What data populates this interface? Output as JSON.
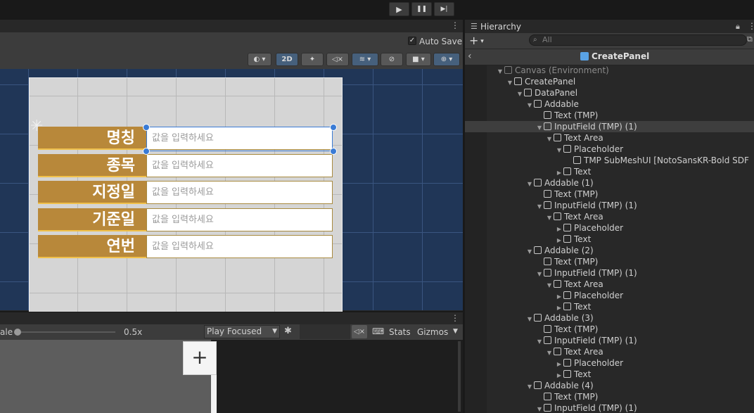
{
  "playbar": {
    "play_icon": "▶",
    "pause_icon": "❚❚",
    "step_icon": "▶|"
  },
  "scene": {
    "auto_save_label": "Auto Save",
    "mode_2d_label": "2D",
    "rows": [
      {
        "label": "명칭",
        "placeholder": "값을 입력하세요"
      },
      {
        "label": "종목",
        "placeholder": "값을 입력하세요"
      },
      {
        "label": "지정일",
        "placeholder": "값을 입력하세요"
      },
      {
        "label": "기준일",
        "placeholder": "값을 입력하세요"
      },
      {
        "label": "연번",
        "placeholder": "값을 입력하세요"
      }
    ]
  },
  "game": {
    "scale_label": "ale",
    "scale_value": "0.5x",
    "play_mode": "Play Focused",
    "stats_label": "Stats",
    "gizmos_label": "Gizmos",
    "add_label": "+"
  },
  "hierarchy": {
    "tab_label": "Hierarchy",
    "search_placeholder": "All",
    "breadcrumb_title": "CreatePanel",
    "items": [
      {
        "label": "Canvas (Environment)",
        "indent": 0,
        "expanded": true,
        "dim": true
      },
      {
        "label": "CreatePanel",
        "indent": 1,
        "expanded": true
      },
      {
        "label": "DataPanel",
        "indent": 2,
        "expanded": true
      },
      {
        "label": "Addable",
        "indent": 3,
        "expanded": true
      },
      {
        "label": "Text (TMP)",
        "indent": 4,
        "expanded": null
      },
      {
        "label": "InputField (TMP) (1)",
        "indent": 4,
        "expanded": true,
        "selected": true
      },
      {
        "label": "Text Area",
        "indent": 5,
        "expanded": true
      },
      {
        "label": "Placeholder",
        "indent": 6,
        "expanded": true
      },
      {
        "label": "TMP SubMeshUI [NotoSansKR-Bold SDF",
        "indent": 7,
        "expanded": null
      },
      {
        "label": "Text",
        "indent": 6,
        "expanded": false
      },
      {
        "label": "Addable (1)",
        "indent": 3,
        "expanded": true
      },
      {
        "label": "Text (TMP)",
        "indent": 4,
        "expanded": null
      },
      {
        "label": "InputField (TMP) (1)",
        "indent": 4,
        "expanded": true
      },
      {
        "label": "Text Area",
        "indent": 5,
        "expanded": true
      },
      {
        "label": "Placeholder",
        "indent": 6,
        "expanded": false
      },
      {
        "label": "Text",
        "indent": 6,
        "expanded": false
      },
      {
        "label": "Addable (2)",
        "indent": 3,
        "expanded": true
      },
      {
        "label": "Text (TMP)",
        "indent": 4,
        "expanded": null
      },
      {
        "label": "InputField (TMP) (1)",
        "indent": 4,
        "expanded": true
      },
      {
        "label": "Text Area",
        "indent": 5,
        "expanded": true
      },
      {
        "label": "Placeholder",
        "indent": 6,
        "expanded": false
      },
      {
        "label": "Text",
        "indent": 6,
        "expanded": false
      },
      {
        "label": "Addable (3)",
        "indent": 3,
        "expanded": true
      },
      {
        "label": "Text (TMP)",
        "indent": 4,
        "expanded": null
      },
      {
        "label": "InputField (TMP) (1)",
        "indent": 4,
        "expanded": true
      },
      {
        "label": "Text Area",
        "indent": 5,
        "expanded": true
      },
      {
        "label": "Placeholder",
        "indent": 6,
        "expanded": false
      },
      {
        "label": "Text",
        "indent": 6,
        "expanded": false
      },
      {
        "label": "Addable (4)",
        "indent": 3,
        "expanded": true
      },
      {
        "label": "Text (TMP)",
        "indent": 4,
        "expanded": null
      },
      {
        "label": "InputField (TMP) (1)",
        "indent": 4,
        "expanded": true
      }
    ]
  },
  "colors": {
    "label_bg": "#b8883a",
    "accent_blue": "#3a7bd5",
    "viewport_bg": "#203657"
  }
}
